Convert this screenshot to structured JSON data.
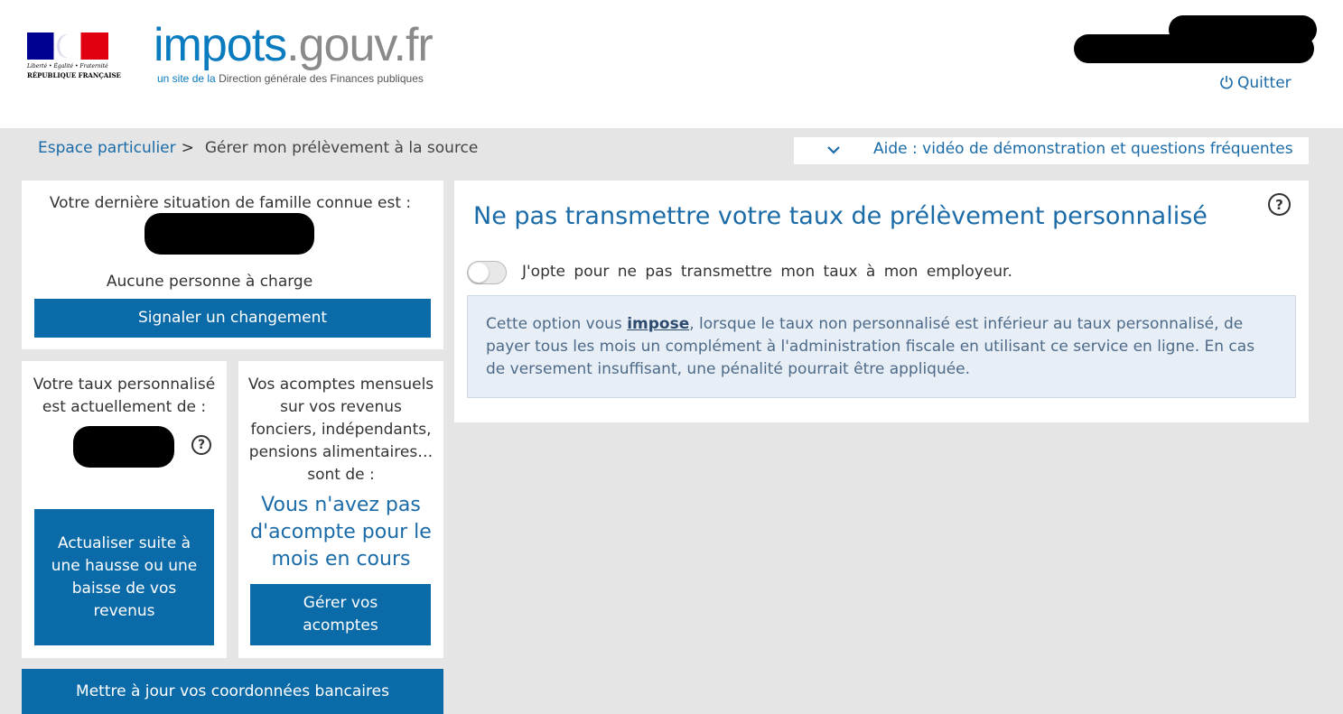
{
  "header": {
    "marianne_motto": "Liberté • Égalité • Fraternité",
    "marianne_republique": "RÉPUBLIQUE FRANÇAISE",
    "logo_main": "impots",
    "logo_domain": ".gouv.fr",
    "logo_sub_prefix": "un site de la",
    "logo_sub_org": "Direction générale des Finances publiques",
    "quit_label": "Quitter"
  },
  "breadcrumb": {
    "home": "Espace particulier",
    "separator": ">",
    "current": "Gérer mon prélèvement à la source"
  },
  "help": {
    "label": "Aide : vidéo de démonstration et questions fréquentes"
  },
  "family": {
    "label": "Votre dernière situation de famille connue est :",
    "dependents": "Aucune personne à charge",
    "change_button": "Signaler un changement"
  },
  "rate": {
    "label": "Votre taux personnalisé est actuellement de :",
    "update_button": "Actualiser suite à une hausse ou une baisse de vos revenus"
  },
  "installments": {
    "label": "Vos acomptes mensuels sur vos revenus fonciers, indépendants, pensions alimentaires… sont de :",
    "value": "Vous n'avez pas d'acompte pour le mois en cours",
    "manage_button": "Gérer vos acomptes"
  },
  "bank": {
    "button": "Mettre à jour vos coordonnées bancaires"
  },
  "main": {
    "title": "Ne pas transmettre votre taux de prélèvement personnalisé",
    "toggle_on": false,
    "option_label": "J'opte pour ne pas transmettre mon taux à mon employeur.",
    "info_before": "Cette option vous ",
    "info_bold": "impose",
    "info_after": ", lorsque le taux non personnalisé est inférieur au taux personnalisé, de payer tous les mois un complément à l'administration fiscale en utilisant ce service en ligne. En cas de versement insuffisant, une pénalité pourrait être appliquée."
  },
  "icons": {
    "help": "question-circle-icon",
    "power": "power-icon",
    "chevron": "chevron-down-icon"
  },
  "colors": {
    "brand_blue": "#0b6aa8",
    "link_blue": "#1a6ba7",
    "background": "#e5e5e5",
    "info_bg": "#e8eef6"
  }
}
